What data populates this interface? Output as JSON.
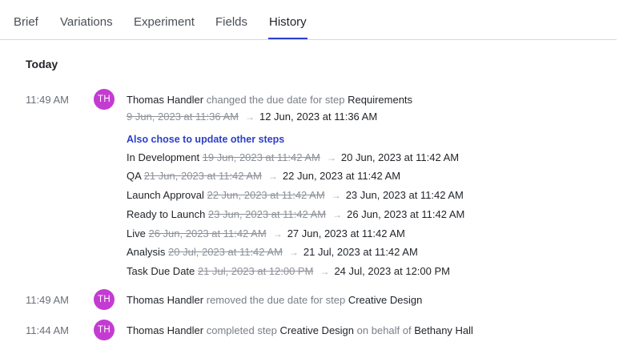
{
  "tabs": [
    {
      "label": "Brief"
    },
    {
      "label": "Variations"
    },
    {
      "label": "Experiment"
    },
    {
      "label": "Fields"
    },
    {
      "label": "History",
      "active": true
    }
  ],
  "section_title": "Today",
  "entries": [
    {
      "time": "11:49 AM",
      "avatar": "TH",
      "user": "Thomas Handler",
      "action": "changed the due date for step",
      "target": "Requirements",
      "old_date": "9 Jun, 2023 at 11:36 AM",
      "new_date": "12 Jun, 2023 at 11:36 AM",
      "extra_title": "Also chose to update other steps",
      "extra_steps": [
        {
          "name": "In Development",
          "old": "19 Jun, 2023 at 11:42 AM",
          "new": "20 Jun, 2023 at 11:42 AM"
        },
        {
          "name": "QA",
          "old": "21 Jun, 2023 at 11:42 AM",
          "new": "22 Jun, 2023 at 11:42 AM"
        },
        {
          "name": "Launch Approval",
          "old": "22 Jun, 2023 at 11:42 AM",
          "new": "23 Jun, 2023 at 11:42 AM"
        },
        {
          "name": "Ready to Launch",
          "old": "23 Jun, 2023 at 11:42 AM",
          "new": "26 Jun, 2023 at 11:42 AM"
        },
        {
          "name": "Live",
          "old": "26 Jun, 2023 at 11:42 AM",
          "new": "27 Jun, 2023 at 11:42 AM"
        },
        {
          "name": "Analysis",
          "old": "20 Jul, 2023 at 11:42 AM",
          "new": "21 Jul, 2023 at 11:42 AM"
        },
        {
          "name": "Task Due Date",
          "old": "21 Jul, 2023 at 12:00 PM",
          "new": "24 Jul, 2023 at 12:00 PM"
        }
      ]
    },
    {
      "time": "11:49 AM",
      "avatar": "TH",
      "user": "Thomas Handler",
      "action": "removed the due date for step",
      "target": "Creative Design"
    },
    {
      "time": "11:44 AM",
      "avatar": "TH",
      "user": "Thomas Handler",
      "action": "completed step",
      "target": "Creative Design",
      "connector": "on behalf of",
      "beneficiary": "Bethany Hall"
    }
  ],
  "colors": {
    "accent": "#2b3fcf",
    "avatar": "#c43bd2",
    "subheading": "#2d3fc6"
  },
  "icons": {
    "arrow": "arrow-right-icon"
  }
}
